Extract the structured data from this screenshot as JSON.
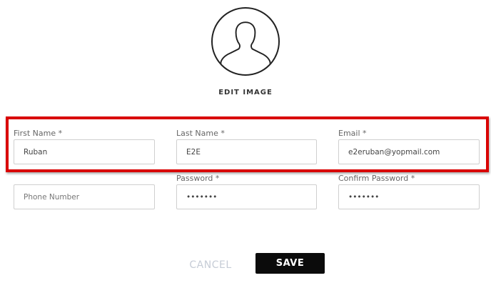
{
  "profile": {
    "edit_image_label": "EDIT IMAGE"
  },
  "form": {
    "first_name": {
      "label": "First Name *",
      "value": "Ruban"
    },
    "last_name": {
      "label": "Last Name *",
      "value": "E2E"
    },
    "email": {
      "label": "Email *",
      "value": "e2eruban@yopmail.com"
    },
    "phone": {
      "placeholder": "Phone Number",
      "value": ""
    },
    "password": {
      "label": "Password *",
      "value": "•••••••"
    },
    "confirm_password": {
      "label": "Confirm Password *",
      "value": "•••••••"
    }
  },
  "actions": {
    "cancel_label": "CANCEL",
    "save_label": "SAVE"
  },
  "colors": {
    "highlight": "#d90000",
    "save_bg": "#0b0b0b",
    "cancel_text": "#c6ccd6"
  }
}
